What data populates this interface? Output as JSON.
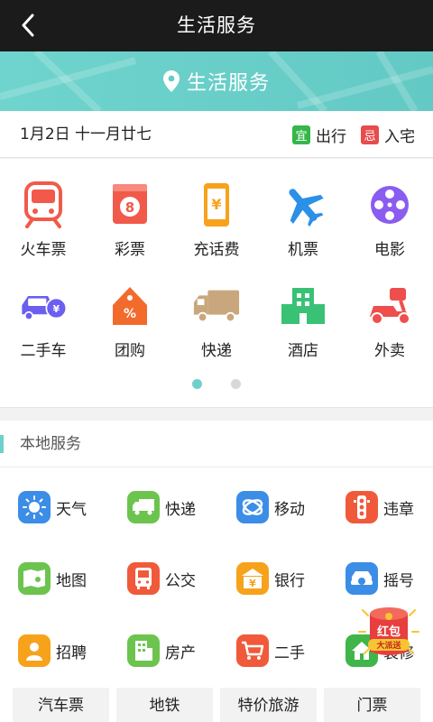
{
  "header": {
    "title": "生活服务",
    "back_icon": "back-arrow-icon"
  },
  "banner": {
    "label": "生活服务",
    "icon": "location-pin-icon",
    "color": "#68cec8"
  },
  "datebar": {
    "date": "1月2日 十一月廿七",
    "good_tag": "宜",
    "good_text": "出行",
    "bad_tag": "忌",
    "bad_text": "入宅"
  },
  "services": [
    {
      "label": "火车票",
      "icon": "train-icon",
      "color": "#f15a4a"
    },
    {
      "label": "彩票",
      "icon": "lottery-icon",
      "color": "#f15a4a"
    },
    {
      "label": "充话费",
      "icon": "phone-recharge-icon",
      "color": "#f7a21b"
    },
    {
      "label": "机票",
      "icon": "airplane-icon",
      "color": "#2a90e8"
    },
    {
      "label": "电影",
      "icon": "film-reel-icon",
      "color": "#8b5cf0"
    },
    {
      "label": "二手车",
      "icon": "used-car-icon",
      "color": "#6b5ef0"
    },
    {
      "label": "团购",
      "icon": "group-buy-tag-icon",
      "color": "#f26b2c"
    },
    {
      "label": "快递",
      "icon": "delivery-truck-icon",
      "color": "#c9a77c"
    },
    {
      "label": "酒店",
      "icon": "hotel-icon",
      "color": "#39c275"
    },
    {
      "label": "外卖",
      "icon": "scooter-icon",
      "color": "#ef4e4e"
    }
  ],
  "pager": {
    "pages": 2,
    "active": 1
  },
  "local": {
    "title": "本地服务",
    "items": [
      {
        "label": "天气",
        "icon": "sun-icon",
        "color": "#3b8de6"
      },
      {
        "label": "快递",
        "icon": "truck-icon",
        "color": "#6cc44e"
      },
      {
        "label": "移动",
        "icon": "china-mobile-icon",
        "color": "#3b8de6"
      },
      {
        "label": "违章",
        "icon": "traffic-light-icon",
        "color": "#f05a3a"
      },
      {
        "label": "地图",
        "icon": "map-icon",
        "color": "#6cc44e"
      },
      {
        "label": "公交",
        "icon": "bus-icon",
        "color": "#f05a3a"
      },
      {
        "label": "银行",
        "icon": "bank-icon",
        "color": "#f7a21b"
      },
      {
        "label": "摇号",
        "icon": "car-lottery-icon",
        "color": "#3b8de6"
      },
      {
        "label": "招聘",
        "icon": "person-icon",
        "color": "#f7a21b"
      },
      {
        "label": "房产",
        "icon": "building-icon",
        "color": "#6cc44e"
      },
      {
        "label": "二手",
        "icon": "cart-icon",
        "color": "#f05a3a"
      },
      {
        "label": "装修",
        "icon": "house-icon",
        "color": "#3fb54a"
      }
    ]
  },
  "chips": [
    "汽车票",
    "地铁",
    "特价旅游",
    "门票"
  ],
  "redpack": {
    "line1": "红包",
    "line2": "大派送",
    "icon": "red-envelope-icon"
  }
}
